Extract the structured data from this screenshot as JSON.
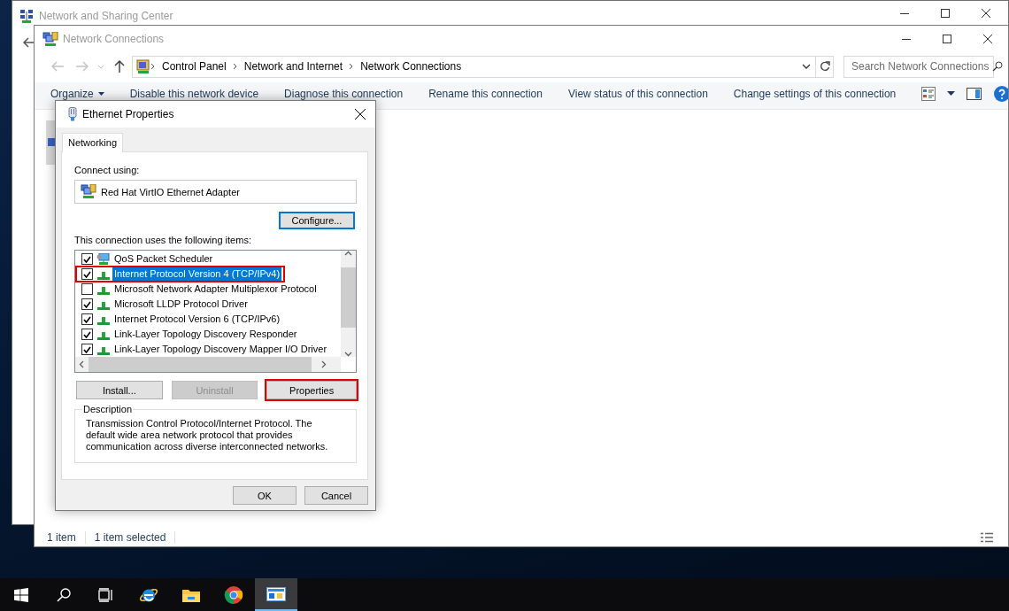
{
  "background_window": {
    "title": "Network and Sharing Center"
  },
  "window": {
    "title": "Network Connections",
    "address": [
      "Control Panel",
      "Network and Internet",
      "Network Connections"
    ],
    "search": {
      "placeholder": "Search Network Connections"
    },
    "toolbar": {
      "organize": "Organize",
      "actions": [
        "Disable this network device",
        "Diagnose this connection",
        "Rename this connection",
        "View status of this connection",
        "Change settings of this connection"
      ]
    },
    "status_bar": [
      "1 item",
      "1 item selected"
    ]
  },
  "dialog": {
    "title": "Ethernet Properties",
    "tabs": [
      {
        "label": "Networking",
        "selected": true
      }
    ],
    "connect_using_label": "Connect using:",
    "adapter": "Red Hat VirtIO Ethernet Adapter",
    "configure_button": "Configure...",
    "items_label": "This connection uses the following items:",
    "items": [
      {
        "label": "QoS Packet Scheduler",
        "kind": "service",
        "checked": true,
        "selected": false,
        "annotated": false
      },
      {
        "label": "Internet Protocol Version 4 (TCP/IPv4)",
        "kind": "protocol",
        "checked": true,
        "selected": true,
        "annotated": true
      },
      {
        "label": "Microsoft Network Adapter Multiplexor Protocol",
        "kind": "protocol",
        "checked": false,
        "selected": false,
        "annotated": false
      },
      {
        "label": "Microsoft LLDP Protocol Driver",
        "kind": "protocol",
        "checked": true,
        "selected": false,
        "annotated": false
      },
      {
        "label": "Internet Protocol Version 6 (TCP/IPv6)",
        "kind": "protocol",
        "checked": true,
        "selected": false,
        "annotated": false
      },
      {
        "label": "Link-Layer Topology Discovery Responder",
        "kind": "protocol",
        "checked": true,
        "selected": false,
        "annotated": false
      },
      {
        "label": "Link-Layer Topology Discovery Mapper I/O Driver",
        "kind": "protocol",
        "checked": true,
        "selected": false,
        "annotated": false
      }
    ],
    "buttons": [
      {
        "label": "Install...",
        "disabled": false,
        "annotated": false
      },
      {
        "label": "Uninstall",
        "disabled": true,
        "annotated": false
      },
      {
        "label": "Properties",
        "disabled": false,
        "annotated": true
      }
    ],
    "description": {
      "title": "Description",
      "text": "Transmission Control Protocol/Internet Protocol. The default wide area network protocol that provides communication across diverse interconnected networks."
    },
    "footer_buttons": [
      "OK",
      "Cancel"
    ]
  },
  "taskbar": [
    {
      "kind": "start",
      "active": false
    },
    {
      "kind": "search",
      "active": false
    },
    {
      "kind": "task-view",
      "active": false
    },
    {
      "kind": "ie",
      "active": false
    },
    {
      "kind": "explorer",
      "active": false
    },
    {
      "kind": "chrome",
      "active": false
    },
    {
      "kind": "network",
      "active": true
    }
  ]
}
